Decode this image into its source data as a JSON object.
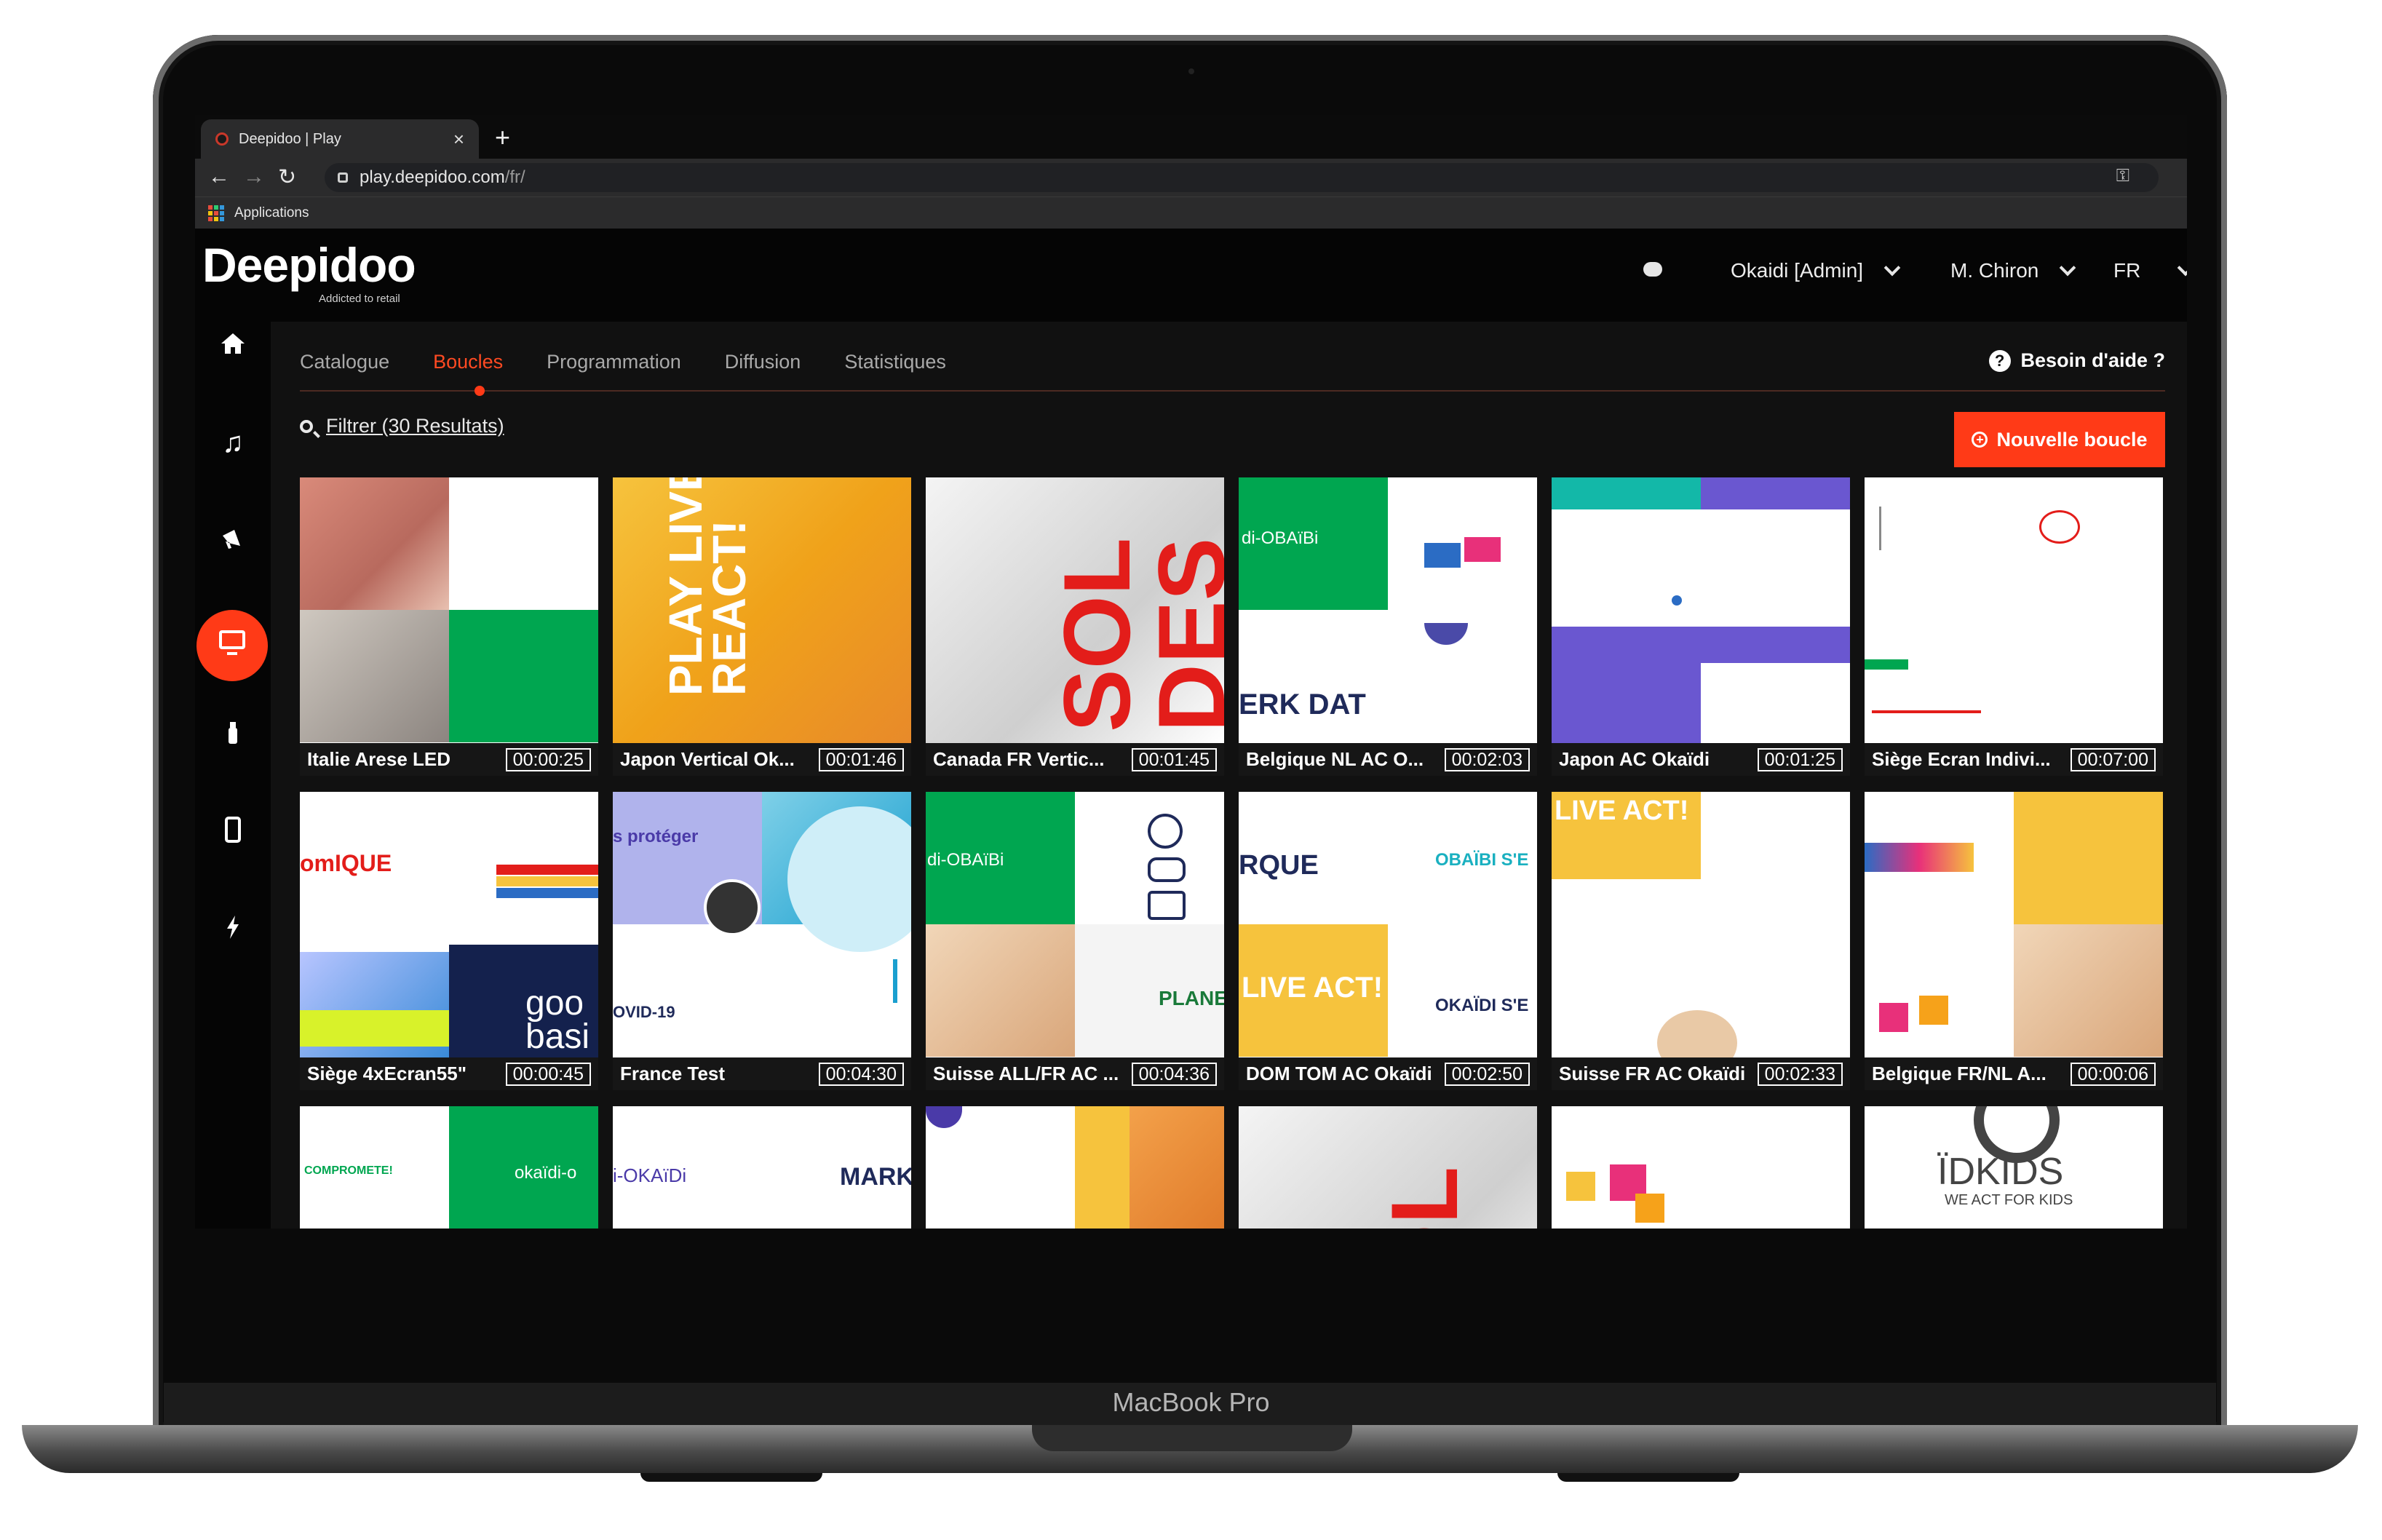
{
  "device": {
    "label": "MacBook Pro"
  },
  "browser": {
    "tab_title": "Deepidoo | Play",
    "url_host": "play.deepidoo.com",
    "url_path": "/fr/",
    "bookmark_label": "Applications"
  },
  "app": {
    "logo": "Deepidoo",
    "tagline": "Addicted to retail",
    "account": "Okaidi [Admin]",
    "user": "M. Chiron",
    "language": "FR",
    "nav_tabs": [
      "Catalogue",
      "Boucles",
      "Programmation",
      "Diffusion",
      "Statistiques"
    ],
    "active_tab": "Boucles",
    "help_label": "Besoin d'aide ?",
    "filter_label": "Filtrer (30 Resultats)",
    "new_loop_label": "Nouvelle boucle",
    "accent_color": "#ff3a17",
    "sidebar_icons": [
      "home-icon",
      "music-icon",
      "megaphone-icon",
      "monitor-icon",
      "spray-icon",
      "phone-icon",
      "bolt-icon"
    ]
  },
  "loops": [
    {
      "name": "Italie Arese LED",
      "duration": "00:00:25"
    },
    {
      "name": "Japon Vertical Ok...",
      "duration": "00:01:46"
    },
    {
      "name": "Canada FR Vertic...",
      "duration": "00:01:45"
    },
    {
      "name": "Belgique NL AC O...",
      "duration": "00:02:03"
    },
    {
      "name": "Japon AC Okaïdi",
      "duration": "00:01:25"
    },
    {
      "name": "Siège Ecran Indivi...",
      "duration": "00:07:00"
    },
    {
      "name": "Siège 4xEcran55\"",
      "duration": "00:00:45"
    },
    {
      "name": "France Test",
      "duration": "00:04:30"
    },
    {
      "name": "Suisse ALL/FR AC ...",
      "duration": "00:04:36"
    },
    {
      "name": "DOM TOM AC Okaïdi",
      "duration": "00:02:50"
    },
    {
      "name": "Suisse FR AC Okaïdi",
      "duration": "00:02:33"
    },
    {
      "name": "Belgique FR/NL A...",
      "duration": "00:00:06"
    }
  ],
  "thumb_text": {
    "playlive": "PLAY LIVE REACT!",
    "sol": "SOL",
    "des": "DES",
    "obaibi": "di-OBAïBi",
    "erk": "ERK DAT",
    "omique": "omIQUE",
    "goo": "goo",
    "basi": "basi",
    "proteger": "s protéger",
    "covid": "OVID-19",
    "arque": "RQUE",
    "confort": "OBAÏBI S'E",
    "okaidi_se": "OKAÏDI S'E",
    "liveact": "LIVE ACT!",
    "comprometi": "COMPROMETE!",
    "okaidi": "okaïdi-o",
    "mark": "MARK",
    "okaidi2": "i-OKAïDi",
    "idkids": "ÏDKIDS",
    "weact": "WE ACT FOR KIDS"
  }
}
